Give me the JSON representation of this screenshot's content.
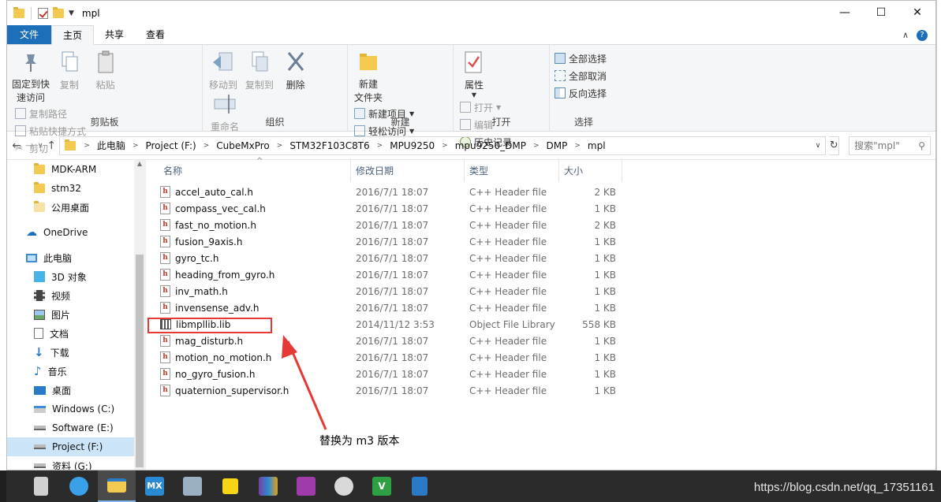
{
  "window": {
    "title": "mpl"
  },
  "window_controls": {
    "minimize": "—",
    "maximize": "☐",
    "close": "✕"
  },
  "tabs": [
    "文件",
    "主页",
    "共享",
    "查看"
  ],
  "ribbon": {
    "clipboard": {
      "label": "剪贴板",
      "pin": "固定到快\n速访问",
      "copy": "复制",
      "paste": "粘贴",
      "copy_path": "复制路径",
      "paste_shortcut": "粘贴快捷方式",
      "cut": "剪切"
    },
    "organize": {
      "label": "组织",
      "move_to": "移动到",
      "copy_to": "复制到",
      "delete": "删除",
      "rename": "重命名"
    },
    "new": {
      "label": "新建",
      "new_folder": "新建\n文件夹",
      "new_item": "新建项目",
      "easy_access": "轻松访问"
    },
    "open": {
      "label": "打开",
      "properties": "属性",
      "open": "打开",
      "edit": "编辑",
      "history": "历史记录"
    },
    "select": {
      "label": "选择",
      "select_all": "全部选择",
      "select_none": "全部取消",
      "invert": "反向选择"
    }
  },
  "address": {
    "crumbs": [
      "此电脑",
      "Project (F:)",
      "CubeMxPro",
      "STM32F103C8T6",
      "MPU9250",
      "mpu9250_DMP",
      "DMP",
      "mpl"
    ],
    "search_placeholder": "搜索\"mpl\""
  },
  "nav": {
    "quick": [
      "MDK-ARM",
      "stm32",
      "公用桌面"
    ],
    "onedrive": "OneDrive",
    "pc": "此电脑",
    "pc_items": [
      "3D 对象",
      "视频",
      "图片",
      "文档",
      "下载",
      "音乐",
      "桌面",
      "Windows (C:)",
      "Software (E:)",
      "Project (F:)",
      "资料 (G:)"
    ]
  },
  "columns": {
    "name": "名称",
    "date": "修改日期",
    "type": "类型",
    "size": "大小"
  },
  "files": [
    {
      "name": "accel_auto_cal.h",
      "date": "2016/7/1 18:07",
      "type": "C++ Header file",
      "size": "2 KB",
      "icon": "header-icon"
    },
    {
      "name": "compass_vec_cal.h",
      "date": "2016/7/1 18:07",
      "type": "C++ Header file",
      "size": "1 KB",
      "icon": "header-icon"
    },
    {
      "name": "fast_no_motion.h",
      "date": "2016/7/1 18:07",
      "type": "C++ Header file",
      "size": "2 KB",
      "icon": "header-icon"
    },
    {
      "name": "fusion_9axis.h",
      "date": "2016/7/1 18:07",
      "type": "C++ Header file",
      "size": "1 KB",
      "icon": "header-icon"
    },
    {
      "name": "gyro_tc.h",
      "date": "2016/7/1 18:07",
      "type": "C++ Header file",
      "size": "1 KB",
      "icon": "header-icon"
    },
    {
      "name": "heading_from_gyro.h",
      "date": "2016/7/1 18:07",
      "type": "C++ Header file",
      "size": "1 KB",
      "icon": "header-icon"
    },
    {
      "name": "inv_math.h",
      "date": "2016/7/1 18:07",
      "type": "C++ Header file",
      "size": "1 KB",
      "icon": "header-icon"
    },
    {
      "name": "invensense_adv.h",
      "date": "2016/7/1 18:07",
      "type": "C++ Header file",
      "size": "1 KB",
      "icon": "header-icon"
    },
    {
      "name": "libmpllib.lib",
      "date": "2014/11/12 3:53",
      "type": "Object File Library",
      "size": "558 KB",
      "icon": "library-icon"
    },
    {
      "name": "mag_disturb.h",
      "date": "2016/7/1 18:07",
      "type": "C++ Header file",
      "size": "1 KB",
      "icon": "header-icon"
    },
    {
      "name": "motion_no_motion.h",
      "date": "2016/7/1 18:07",
      "type": "C++ Header file",
      "size": "1 KB",
      "icon": "header-icon"
    },
    {
      "name": "no_gyro_fusion.h",
      "date": "2016/7/1 18:07",
      "type": "C++ Header file",
      "size": "1 KB",
      "icon": "header-icon"
    },
    {
      "name": "quaternion_supervisor.h",
      "date": "2016/7/1 18:07",
      "type": "C++ Header file",
      "size": "1 KB",
      "icon": "header-icon"
    }
  ],
  "annotation": {
    "text": "替换为 m3 版本",
    "color": "#e53935"
  },
  "watermark": "https://blog.csdn.net/qq_17351161",
  "taskbar_apps": [
    "pdf-app-icon",
    "edge-browser-icon",
    "file-explorer-icon",
    "mx-app-icon",
    "image-viewer-icon",
    "sticky-notes-icon",
    "winrar-icon",
    "onenote-icon",
    "avatar-app-icon",
    "visual-studio-icon",
    "calculator-icon"
  ],
  "colors": {
    "accent": "#1e6fb9",
    "selection": "#cce4f7",
    "highlight": "#e53935"
  }
}
